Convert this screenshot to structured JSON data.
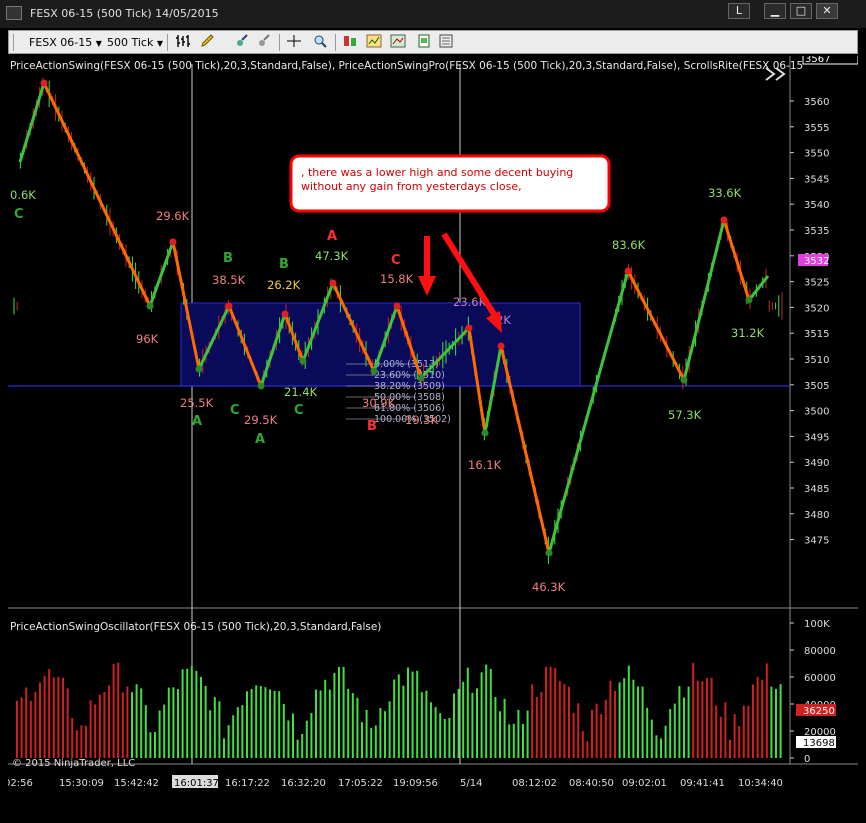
{
  "window": {
    "title": "FESX 06-15 (500 Tick)  14/05/2015",
    "layout_button": "L",
    "min": "▁",
    "max": "□",
    "close": "✕"
  },
  "toolbar": {
    "instrument": "FESX 06-15",
    "interval": "500 Tick"
  },
  "price_panel": {
    "indicator_label": "PriceActionSwing(FESX 06-15 (500 Tick),20,3,Standard,False), PriceActionSwingPro(FESX 06-15 (500 Tick),20,3,Standard,False), ScrollsRite(FESX 06-15",
    "y_ticks": [
      "3560",
      "3555",
      "3550",
      "3545",
      "3540",
      "3535",
      "3530",
      "3525",
      "3520",
      "3515",
      "3510",
      "3505",
      "3500",
      "3495",
      "3490",
      "3485",
      "3480",
      "3475"
    ],
    "top_tag": "3567",
    "current_price_tag": "3532",
    "note_text": ", there was a lower high and some decent buying without any gain from yesterdays close,",
    "labels": [
      {
        "text": "0.6K",
        "color": "#8fe06a"
      },
      {
        "text": "C",
        "color": "#2fa82f"
      },
      {
        "text": "29.6K",
        "color": "#f08080"
      },
      {
        "text": "96K",
        "color": "#f08080"
      },
      {
        "text": "38.5K",
        "color": "#f08080"
      },
      {
        "text": "B",
        "color": "#2fa82f"
      },
      {
        "text": "B",
        "color": "#2fa82f"
      },
      {
        "text": "26.2K",
        "color": "#f0d040"
      },
      {
        "text": "47.3K",
        "color": "#8fe06a"
      },
      {
        "text": "A",
        "color": "#ff3030"
      },
      {
        "text": "C",
        "color": "#ff3030"
      },
      {
        "text": "15.8K",
        "color": "#f08080"
      },
      {
        "text": "25.5K",
        "color": "#f08080"
      },
      {
        "text": "C",
        "color": "#2fa82f"
      },
      {
        "text": "A",
        "color": "#2fa82f"
      },
      {
        "text": "29.5K",
        "color": "#f08080"
      },
      {
        "text": "A",
        "color": "#2fa82f"
      },
      {
        "text": "21.4K",
        "color": "#8fe06a"
      },
      {
        "text": "C",
        "color": "#2fa82f"
      },
      {
        "text": "19.3K",
        "color": "#f08080"
      },
      {
        "text": "B",
        "color": "#ff3030"
      },
      {
        "text": "30.9K",
        "color": "#f08080"
      },
      {
        "text": "23.6K",
        "color": "#c080c0"
      },
      {
        "text": "2K",
        "color": "#c080c0"
      },
      {
        "text": "16.1K",
        "color": "#f08080"
      },
      {
        "text": "46.3K",
        "color": "#f08080"
      },
      {
        "text": "83.6K",
        "color": "#8fe06a"
      },
      {
        "text": "57.3K",
        "color": "#8fe06a"
      },
      {
        "text": "33.6K",
        "color": "#8fe06a"
      },
      {
        "text": "31.2K",
        "color": "#8fe06a"
      }
    ],
    "fib_levels": [
      "0.00% (3513)",
      "23.60% (3510)",
      "38.20% (3509)",
      "50.00% (3508)",
      "61.80% (3506)",
      "100.00% (3502)"
    ]
  },
  "oscillator_panel": {
    "indicator_label": "PriceActionSwingOscillator(FESX 06-15 (500 Tick),20,3,Standard,False)",
    "y_ticks": [
      "100K",
      "80000",
      "60000",
      "40000",
      "20000",
      "0"
    ],
    "tag_red": "36250",
    "tag_white": "13698"
  },
  "x_axis": {
    "ticks": [
      "02:56",
      "15:30:09",
      "15:42:42",
      "16:01:37",
      "16:17:22",
      "16:32:20",
      "17:05:22",
      "19:09:56",
      "5/14",
      "08:12:02",
      "08:40:50",
      "09:02:01",
      "09:41:41",
      "10:34:40"
    ]
  },
  "copyright": "© 2015 NinjaTrader, LLC",
  "colors": {
    "swing_down": "#ff6a00",
    "swing_up": "#3cc43c",
    "bar_up": "#40e040",
    "bar_down": "#d02020",
    "zone_fill": "#0a0a5a",
    "zone_border": "#2a2adc",
    "note_border": "#ff0000",
    "crosshair": "#cccccc"
  }
}
